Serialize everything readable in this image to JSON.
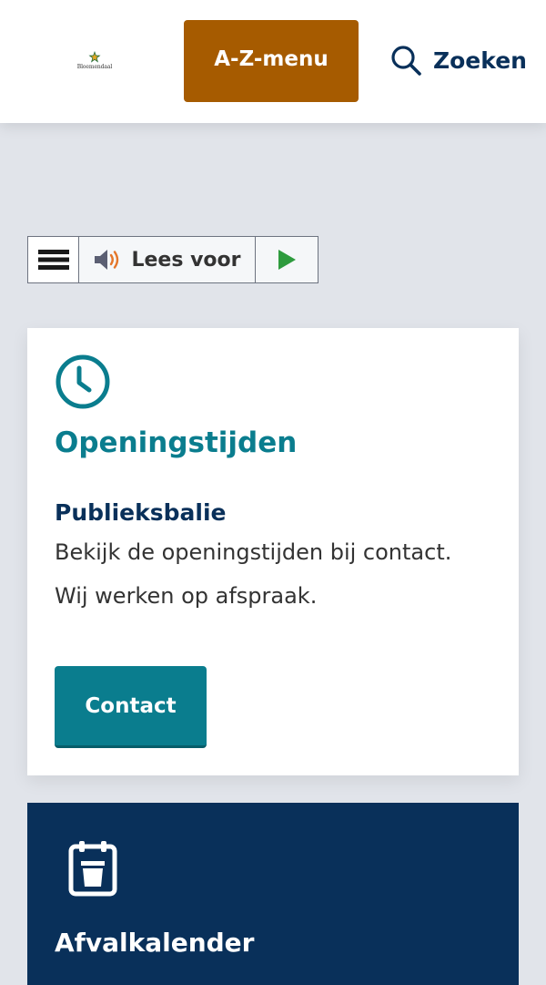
{
  "header": {
    "logo_text": "Bloemendaal",
    "az_menu_label": "A-Z-menu",
    "search_label": "Zoeken"
  },
  "readspeaker": {
    "read_label": "Lees voor"
  },
  "opening_card": {
    "title": "Openingstijden",
    "subtitle": "Publieksbalie",
    "text": "Bekijk de openingstijden bij contact. Wij werken op afspraak.",
    "button_label": "Contact"
  },
  "waste_card": {
    "title": "Afvalkalender"
  },
  "colors": {
    "brand_navy": "#09305a",
    "teal": "#0a7d8e",
    "az_button": "#a65b00",
    "background": "#e1e4ea"
  },
  "icons": [
    "bloemendaal-logo-icon",
    "search-icon",
    "menu-icon",
    "speaker-icon",
    "play-icon",
    "clock-icon",
    "waste-bin-calendar-icon"
  ]
}
